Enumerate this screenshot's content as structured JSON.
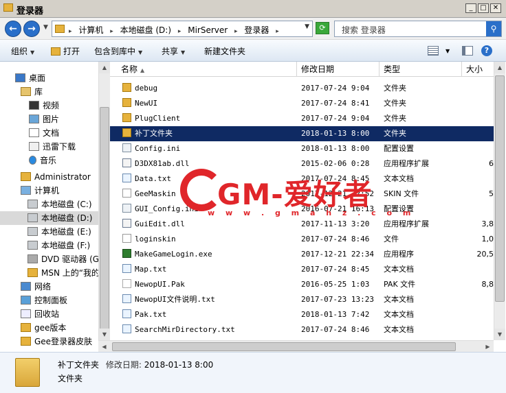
{
  "window": {
    "title": "登录器"
  },
  "address": {
    "crumbs": [
      "计算机",
      "本地磁盘 (D:)",
      "MirServer",
      "登录器"
    ],
    "search_placeholder": "搜索 登录器"
  },
  "toolbar": {
    "organize": "组织",
    "open": "打开",
    "include_in_library": "包含到库中",
    "share": "共享",
    "new_folder": "新建文件夹"
  },
  "nav": {
    "items": [
      {
        "label": "桌面",
        "icon": "desktop-icon"
      },
      {
        "label": "库",
        "icon": "library-icon"
      },
      {
        "label": "视频",
        "icon": "video-icon"
      },
      {
        "label": "图片",
        "icon": "picture-icon"
      },
      {
        "label": "文档",
        "icon": "document-icon"
      },
      {
        "label": "迅雷下载",
        "icon": "download-icon"
      },
      {
        "label": "音乐",
        "icon": "music-icon"
      },
      {
        "label": "Administrator",
        "icon": "user-folder-icon"
      },
      {
        "label": "计算机",
        "icon": "computer-icon"
      },
      {
        "label": "本地磁盘 (C:)",
        "icon": "disk-icon"
      },
      {
        "label": "本地磁盘 (D:)",
        "icon": "disk-icon"
      },
      {
        "label": "本地磁盘 (E:)",
        "icon": "disk-icon"
      },
      {
        "label": "本地磁盘 (F:)",
        "icon": "disk-icon"
      },
      {
        "label": "DVD 驱动器 (G",
        "icon": "dvd-icon"
      },
      {
        "label": "MSN 上的“我的",
        "icon": "folder-icon"
      },
      {
        "label": "网络",
        "icon": "network-icon"
      },
      {
        "label": "控制面板",
        "icon": "control-panel-icon"
      },
      {
        "label": "回收站",
        "icon": "recycle-bin-icon"
      },
      {
        "label": "gee版本",
        "icon": "folder-icon"
      },
      {
        "label": "Gee登录器皮肤",
        "icon": "folder-icon"
      }
    ]
  },
  "columns": {
    "name": "名称",
    "modified": "修改日期",
    "type": "类型",
    "size": "大小"
  },
  "files": [
    {
      "name": "debug",
      "date": "2017-07-24 9:04",
      "type": "文件夹",
      "size": "",
      "icon": "folder"
    },
    {
      "name": "NewUI",
      "date": "2017-07-24 8:41",
      "type": "文件夹",
      "size": "",
      "icon": "folder"
    },
    {
      "name": "PlugClient",
      "date": "2017-07-24 9:04",
      "type": "文件夹",
      "size": "",
      "icon": "folder"
    },
    {
      "name": "补丁文件夹",
      "date": "2018-01-13 8:00",
      "type": "文件夹",
      "size": "",
      "icon": "folder"
    },
    {
      "name": "Config.ini",
      "date": "2018-01-13 8:00",
      "type": "配置设置",
      "size": "",
      "icon": "ini"
    },
    {
      "name": "D3DX81ab.dll",
      "date": "2015-02-06 0:28",
      "type": "应用程序扩展",
      "size": "6",
      "icon": "dll"
    },
    {
      "name": "Data.txt",
      "date": "2017-07-24 8:45",
      "type": "文本文档",
      "size": "",
      "icon": "txt"
    },
    {
      "name": "GeeMaskin",
      "date": "2017-12-21 22:52",
      "type": "SKIN 文件",
      "size": "5",
      "icon": "file"
    },
    {
      "name": "GUI_Config.ini",
      "date": "2016-07-21 16:13",
      "type": "配置设置",
      "size": "",
      "icon": "ini"
    },
    {
      "name": "GuiEdit.dll",
      "date": "2017-11-13 3:20",
      "type": "应用程序扩展",
      "size": "3,8",
      "icon": "dll"
    },
    {
      "name": "loginskin",
      "date": "2017-07-24 8:46",
      "type": "文件",
      "size": "1,0",
      "icon": "file"
    },
    {
      "name": "MakeGameLogin.exe",
      "date": "2017-12-21 22:34",
      "type": "应用程序",
      "size": "20,5",
      "icon": "exe"
    },
    {
      "name": "Map.txt",
      "date": "2017-07-24 8:45",
      "type": "文本文档",
      "size": "",
      "icon": "txt"
    },
    {
      "name": "NewopUI.Pak",
      "date": "2016-05-25 1:03",
      "type": "PAK 文件",
      "size": "8,8",
      "icon": "pak"
    },
    {
      "name": "NewopUI文件说明.txt",
      "date": "2017-07-23 13:23",
      "type": "文本文档",
      "size": "",
      "icon": "txt"
    },
    {
      "name": "Pak.txt",
      "date": "2018-01-13 7:42",
      "type": "文本文档",
      "size": "",
      "icon": "txt"
    },
    {
      "name": "SearchMirDirectory.txt",
      "date": "2017-07-24 8:46",
      "type": "文本文档",
      "size": "",
      "icon": "txt"
    }
  ],
  "selected_index": 3,
  "nav_selected_index": 10,
  "watermark": {
    "brand": "GM-爱好者",
    "url": "w w w . g m a h z . c o m"
  },
  "details": {
    "name": "补丁文件夹",
    "modified_label": "修改日期:",
    "modified_value": "2018-01-13 8:00",
    "type": "文件夹"
  }
}
